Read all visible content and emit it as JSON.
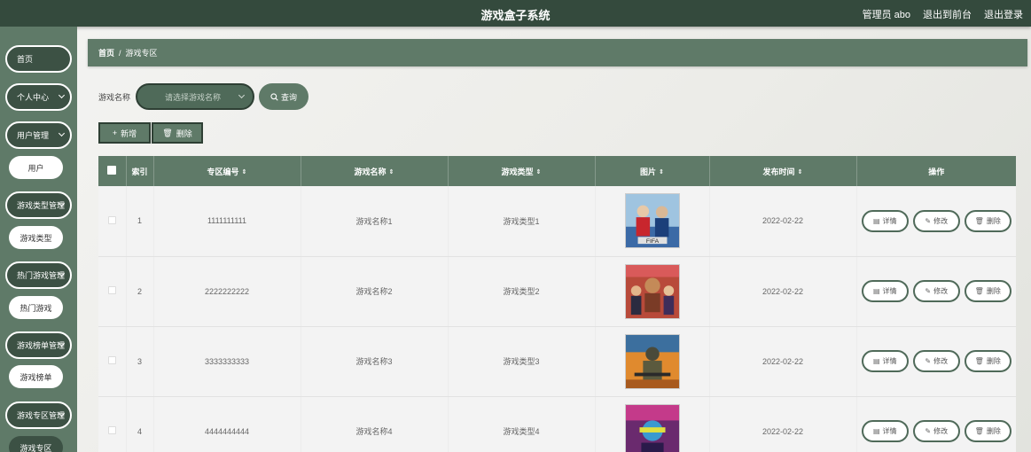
{
  "header": {
    "title": "游戏盒子系统",
    "admin": "管理员 abo",
    "front": "退出到前台",
    "logout": "退出登录"
  },
  "sidebar": {
    "items": [
      {
        "label": "首页",
        "type": "main",
        "chevron": false
      },
      {
        "label": "个人中心",
        "type": "main",
        "chevron": true
      },
      {
        "label": "用户管理",
        "type": "main",
        "chevron": true
      },
      {
        "label": "用户",
        "type": "sub"
      },
      {
        "label": "游戏类型管理",
        "type": "main",
        "chevron": true
      },
      {
        "label": "游戏类型",
        "type": "sub"
      },
      {
        "label": "热门游戏管理",
        "type": "main",
        "chevron": true
      },
      {
        "label": "热门游戏",
        "type": "sub"
      },
      {
        "label": "游戏榜单管理",
        "type": "main",
        "chevron": true
      },
      {
        "label": "游戏榜单",
        "type": "sub"
      },
      {
        "label": "游戏专区管理",
        "type": "main",
        "chevron": true
      },
      {
        "label": "游戏专区",
        "type": "sub"
      }
    ]
  },
  "breadcrumb": {
    "home": "首页",
    "sep": "/",
    "current": "游戏专区"
  },
  "search": {
    "label": "游戏名称",
    "placeholder": "请选择游戏名称",
    "button": "查询"
  },
  "actions": {
    "add": "新增",
    "delete": "删除"
  },
  "table": {
    "headers": [
      "索引",
      "专区编号",
      "游戏名称",
      "游戏类型",
      "图片",
      "发布时间",
      "操作"
    ],
    "rows": [
      {
        "index": "1",
        "code": "1111111111",
        "name": "游戏名称1",
        "type": "游戏类型1",
        "date": "2022-02-22",
        "image": "fifa-cover"
      },
      {
        "index": "2",
        "code": "2222222222",
        "name": "游戏名称2",
        "type": "游戏类型2",
        "date": "2022-02-22",
        "image": "fighters-cover"
      },
      {
        "index": "3",
        "code": "3333333333",
        "name": "游戏名称3",
        "type": "游戏类型3",
        "date": "2022-02-22",
        "image": "pubg-cover"
      },
      {
        "index": "4",
        "code": "4444444444",
        "name": "游戏名称4",
        "type": "游戏类型4",
        "date": "2022-02-22",
        "image": "neon-cover"
      }
    ],
    "ops": {
      "detail": "详情",
      "edit": "修改",
      "delete": "删除"
    }
  },
  "colors": {
    "topbar": "#344a3d",
    "sidebar": "#5f7a68",
    "accent": "#4f6a59"
  }
}
